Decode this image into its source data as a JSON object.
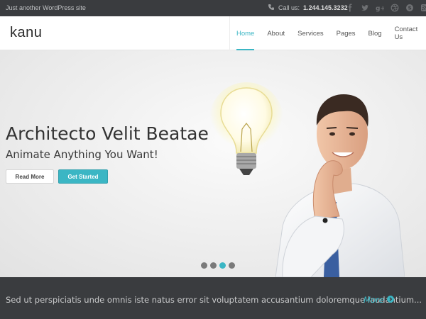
{
  "topbar": {
    "tagline": "Just another WordPress site",
    "call_label": "Call us:",
    "phone": "1.244.145.3232",
    "socials": [
      "facebook-icon",
      "twitter-icon",
      "google-plus-icon",
      "dribbble-icon",
      "skype-icon",
      "rss-icon"
    ]
  },
  "header": {
    "logo": "kanu",
    "nav": [
      "Home",
      "About",
      "Services",
      "Pages",
      "Blog",
      "Contact Us"
    ],
    "active_nav": "Home"
  },
  "hero": {
    "title": "Architecto Velit Beatae",
    "subtitle": "Animate Anything You Want!",
    "read_more": "Read More",
    "get_started": "Get Started",
    "slider_active_index": 2,
    "slider_count": 4
  },
  "banner": {
    "text": "Sed ut perspiciatis unde omnis iste natus error sit voluptatem accusantium doloremque laudantium...",
    "more": "More"
  },
  "colors": {
    "accent": "#3bb6c4",
    "dark_bar": "#3a3c3f"
  }
}
